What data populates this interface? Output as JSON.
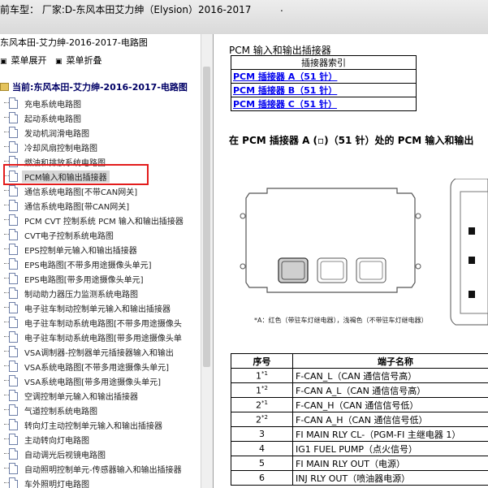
{
  "topbar": {
    "vehicle_line": "前车型：  厂家:D-东风本田艾力绅（Elysion）2016-2017",
    "trailing_mark": "."
  },
  "sidebar": {
    "title": "东风本田-艾力绅-2016-2017-电路图",
    "expand_label": "菜单展开",
    "collapse_label": "菜单折叠",
    "root_label": "当前:东风本田-艾力绅-2016-2017-电路图",
    "items": [
      "充电系统电路图",
      "起动系统电路图",
      "发动机润滑电路图",
      "冷却风扇控制电路图",
      "燃油和排放系统电路图",
      "PCM输入和输出插接器",
      "通信系统电路图[不带CAN网关]",
      "通信系统电路图[带CAN网关]",
      "PCM CVT 控制系统 PCM 输入和输出插接器",
      "CVT电子控制系统电路图",
      "EPS控制单元输入和输出插接器",
      "EPS电路图[不带多用途摄像头单元]",
      "EPS电路图[带多用途摄像头单元]",
      "制动助力器压力监测系统电路图",
      "电子驻车制动控制单元输入和输出插接器",
      "电子驻车制动系统电路图[不带多用途摄像头",
      "电子驻车制动系统电路图[带多用途摄像头单",
      "VSA调制器-控制器单元插接器输入和输出",
      "VSA系统电路图[不带多用途摄像头单元]",
      "VSA系统电路图[带多用途摄像头单元]",
      "空调控制单元输入和输出插接器",
      "气道控制系统电路图",
      "转向灯主动控制单元输入和输出插接器",
      "主动转向灯电路图",
      "自动调光后视镜电路图",
      "自动照明控制单元-传感器输入和输出插接器",
      "车外照明灯电路图"
    ],
    "selected_index": 5
  },
  "content": {
    "heading1": "PCM 输入和输出插接器",
    "index_table": {
      "header": "插接器索引",
      "links": [
        "PCM 插接器 A（51 针）",
        "PCM 插接器 B（51 针）",
        "PCM 插接器 C（51 针）"
      ]
    },
    "heading2": "在 PCM 插接器 A (▫)（51 针）处的 PCM 输入和输出",
    "diagram_note": "*A：红色（带驻车灯继电器），浅褐色（不带驻车灯继电器）",
    "pins_table": {
      "col_no": "序号",
      "col_name": "端子名称",
      "rows": [
        {
          "no": "1",
          "sup": "*1",
          "name": "F-CAN_L（CAN 通信信号高）"
        },
        {
          "no": "1",
          "sup": "*2",
          "name": "F-CAN A_L（CAN 通信信号高）"
        },
        {
          "no": "2",
          "sup": "*1",
          "name": "F-CAN_H（CAN 通信信号低）"
        },
        {
          "no": "2",
          "sup": "*2",
          "name": "F-CAN A_H（CAN 通信信号低）"
        },
        {
          "no": "3",
          "sup": "",
          "name": "FI MAIN RLY CL-（PGM-FI 主继电器 1）"
        },
        {
          "no": "4",
          "sup": "",
          "name": "IG1 FUEL PUMP（点火信号）"
        },
        {
          "no": "5",
          "sup": "",
          "name": "FI MAIN RLY OUT（电源）"
        },
        {
          "no": "6",
          "sup": "",
          "name": "INJ RLY OUT（喷油器电源）"
        }
      ]
    }
  }
}
